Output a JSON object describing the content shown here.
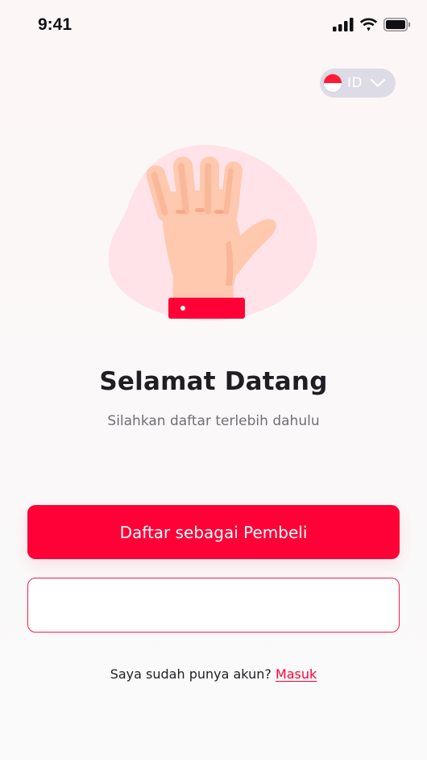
{
  "status_bar": {
    "time": "9:41",
    "icons": [
      "signal-icon",
      "wifi-icon",
      "battery-icon"
    ]
  },
  "language": {
    "code": "ID",
    "flag": "indonesia-flag-icon",
    "chevron": "chevron-down-icon"
  },
  "illustration": {
    "icon": "waving-hand-illustration",
    "colors": {
      "blob": "#ffe3e8",
      "skin": "#ffc9af",
      "skin_shadow": "#f6a98a",
      "cuff": "#ff0037"
    }
  },
  "welcome": {
    "title": "Selamat Datang",
    "subtitle": "Silahkan daftar terlebih dahulu"
  },
  "actions": {
    "register_buyer_label": "Daftar sebagai Pembeli",
    "secondary_label": ""
  },
  "footer": {
    "prompt": "Saya sudah punya akun?",
    "login_link": "Masuk"
  },
  "colors": {
    "primary": "#ff0037",
    "text_dark": "#1e1e24",
    "text_muted": "#6f6f76",
    "pill_bg": "#dcdbe6"
  }
}
